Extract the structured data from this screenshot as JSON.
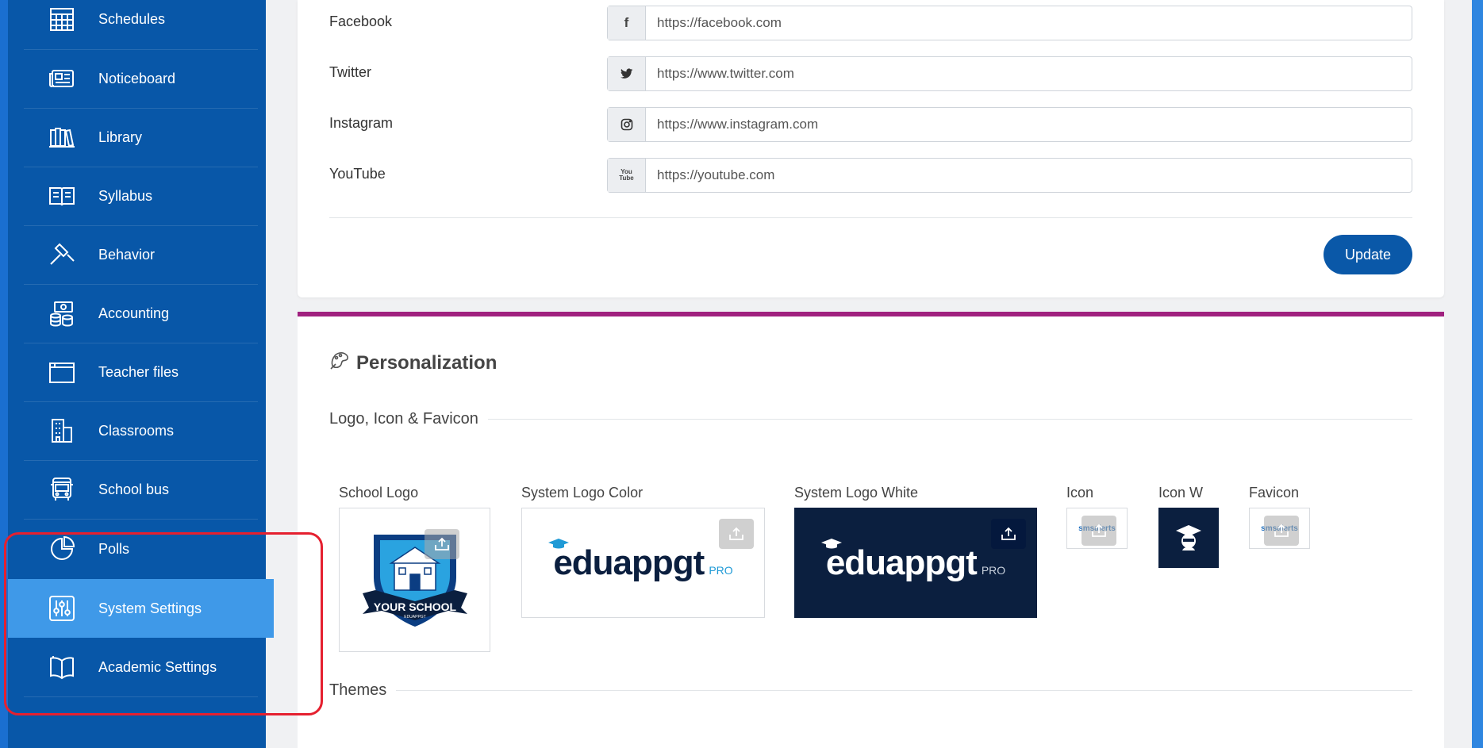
{
  "sidebar": {
    "items": [
      {
        "label": "Schedules",
        "icon": "calendar-icon"
      },
      {
        "label": "Noticeboard",
        "icon": "newspaper-icon"
      },
      {
        "label": "Library",
        "icon": "books-icon"
      },
      {
        "label": "Syllabus",
        "icon": "open-book-icon"
      },
      {
        "label": "Behavior",
        "icon": "gavel-icon"
      },
      {
        "label": "Accounting",
        "icon": "money-icon"
      },
      {
        "label": "Teacher files",
        "icon": "folder-icon"
      },
      {
        "label": "Classrooms",
        "icon": "building-icon"
      },
      {
        "label": "School bus",
        "icon": "bus-icon"
      },
      {
        "label": "Polls",
        "icon": "pie-chart-icon"
      },
      {
        "label": "System Settings",
        "icon": "sliders-icon"
      },
      {
        "label": "Academic Settings",
        "icon": "book-icon"
      }
    ],
    "active": "System Settings"
  },
  "social": {
    "facebook": {
      "label": "Facebook",
      "value": "https://facebook.com",
      "icon_text": "f"
    },
    "twitter": {
      "label": "Twitter",
      "value": "https://www.twitter.com"
    },
    "instagram": {
      "label": "Instagram",
      "value": "https://www.instagram.com"
    },
    "youtube": {
      "label": "YouTube",
      "value": "https://youtube.com",
      "icon_text": "You Tube"
    },
    "update_label": "Update"
  },
  "personalization": {
    "title": "Personalization",
    "logo_section": "Logo, Icon & Favicon",
    "themes_section": "Themes",
    "logos": {
      "school_logo": {
        "label": "School Logo",
        "text1": "YOUR SCHOOL",
        "text2": "EDUAPPGT"
      },
      "system_logo_color": {
        "label": "System Logo Color",
        "brand": "eduappgt",
        "suffix": "PRO"
      },
      "system_logo_white": {
        "label": "System Logo White",
        "brand": "eduappgt",
        "suffix": "PRO"
      },
      "icon": {
        "label": "Icon",
        "brand": "smsalerts"
      },
      "icon_w": {
        "label": "Icon W"
      },
      "favicon": {
        "label": "Favicon",
        "brand": "smsalerts"
      }
    }
  },
  "colors": {
    "sidebar": "#0857a8",
    "active": "#3f99e8",
    "accent": "#a0217f",
    "button": "#0a58a8",
    "navy": "#0b1f3f"
  }
}
